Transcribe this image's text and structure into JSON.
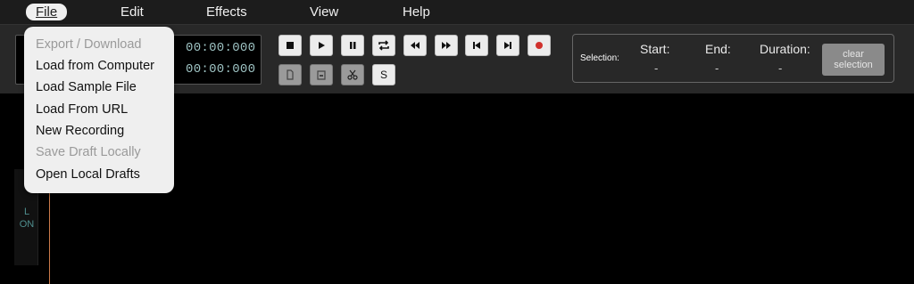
{
  "menubar": {
    "items": [
      {
        "label": "File"
      },
      {
        "label": "Edit"
      },
      {
        "label": "Effects"
      },
      {
        "label": "View"
      },
      {
        "label": "Help"
      }
    ]
  },
  "time": {
    "current": "00:00:000",
    "total": "00:00:000"
  },
  "transport": {
    "buttons": [
      "stop-icon",
      "play-icon",
      "pause-icon",
      "loop-icon",
      "rewind-icon",
      "fast-forward-icon",
      "skip-start-icon",
      "skip-end-icon",
      "record-icon"
    ],
    "record_color": "#d0312d",
    "second_row": [
      "copy-icon",
      "paste-icon",
      "cut-icon"
    ],
    "silence_label": "S"
  },
  "selection": {
    "label": "Selection:",
    "start_label": "Start:",
    "end_label": "End:",
    "duration_label": "Duration:",
    "start_value": "-",
    "end_value": "-",
    "duration_value": "-",
    "clear_line1": "clear",
    "clear_line2": "selection"
  },
  "channel": {
    "name": "L",
    "status": "ON"
  },
  "file_menu": {
    "items": [
      {
        "label": "Export / Download",
        "enabled": false
      },
      {
        "label": "Load from Computer",
        "enabled": true
      },
      {
        "label": "Load Sample File",
        "enabled": true
      },
      {
        "label": "Load From URL",
        "enabled": true
      },
      {
        "label": "New Recording",
        "enabled": true
      },
      {
        "label": "Save Draft Locally",
        "enabled": false
      },
      {
        "label": "Open Local Drafts",
        "enabled": true
      }
    ]
  },
  "colors": {
    "time_text": "#9ec3c3",
    "channel_text": "#4f8f8f",
    "cursor": "#c97a4a"
  }
}
